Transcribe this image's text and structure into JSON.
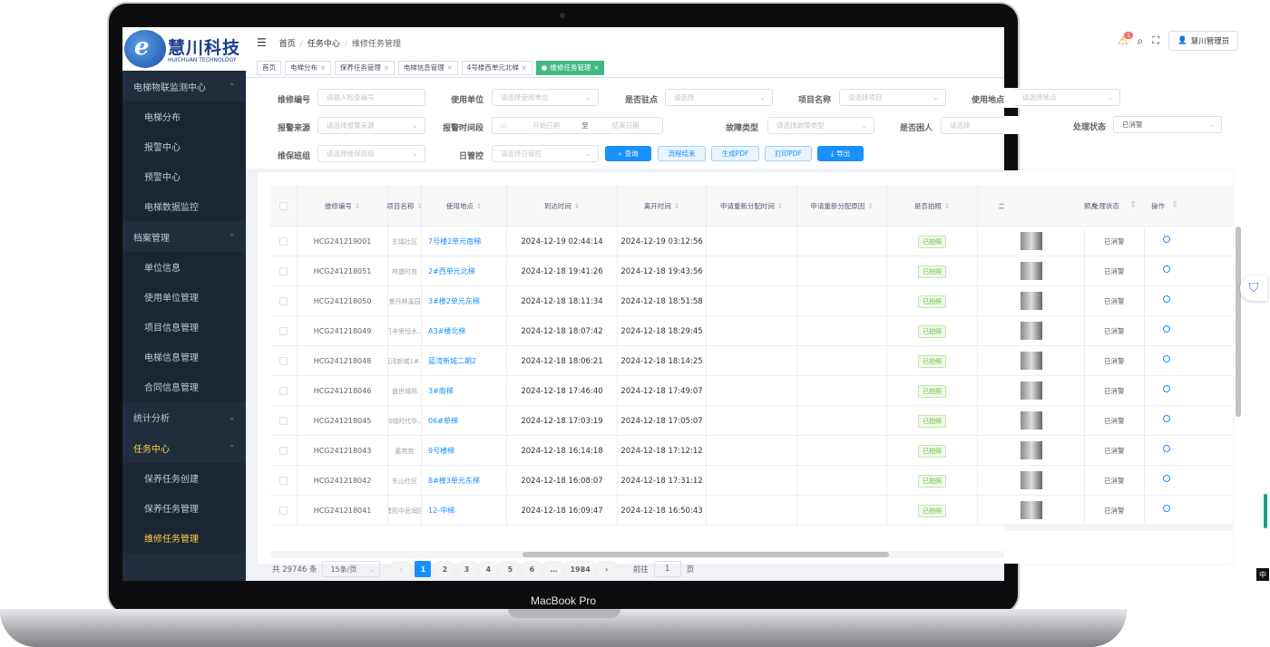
{
  "device": {
    "brand_label": "MacBook Pro"
  },
  "header": {
    "logo_cn": "慧川科技",
    "logo_en": "HUICHUAN TECHNOLOGY",
    "breadcrumb": [
      "首页",
      "任务中心",
      "维修任务管理"
    ],
    "notification_count": "1",
    "user_label": "慧川管理员"
  },
  "tabs": [
    {
      "label": "首页",
      "closable": false,
      "active": false
    },
    {
      "label": "电梯分布",
      "closable": true,
      "active": false
    },
    {
      "label": "保养任务管理",
      "closable": true,
      "active": false
    },
    {
      "label": "电梯信息管理",
      "closable": true,
      "active": false
    },
    {
      "label": "4号楼西单元北梯",
      "closable": true,
      "active": false
    },
    {
      "label": "维修任务管理",
      "closable": true,
      "active": true
    }
  ],
  "sidebar": {
    "groups": [
      {
        "label": "电梯物联监测中心",
        "expanded": true,
        "items": [
          "电梯分布",
          "报警中心",
          "预警中心",
          "电梯数据监控"
        ]
      },
      {
        "label": "档案管理",
        "expanded": true,
        "items": [
          "单位信息",
          "使用单位管理",
          "项目信息管理",
          "电梯信息管理",
          "合同信息管理"
        ]
      },
      {
        "label": "统计分析",
        "expanded": false,
        "items": []
      },
      {
        "label": "任务中心",
        "expanded": true,
        "active": true,
        "items": [
          "保养任务创建",
          "保养任务管理",
          "维修任务管理"
        ]
      }
    ],
    "active_item": "维修任务管理"
  },
  "filters": {
    "row1": [
      {
        "label": "维修编号",
        "placeholder": "请输入检查编号"
      },
      {
        "label": "使用单位",
        "placeholder": "请选择使用单位"
      },
      {
        "label": "是否驻点",
        "placeholder": "请选择"
      },
      {
        "label": "项目名称",
        "placeholder": "请选择项目"
      },
      {
        "label": "使用地点",
        "placeholder": "请选择地点"
      }
    ],
    "row2": [
      {
        "label": "报警来源",
        "placeholder": "请选择报警来源"
      },
      {
        "label": "报警时间段",
        "start": "开始日期",
        "to": "至",
        "end": "结束日期"
      },
      {
        "label": "故障类型",
        "placeholder": "请选择故障类型"
      },
      {
        "label": "是否困人",
        "placeholder": "请选择"
      },
      {
        "label": "处理状态",
        "value": "已消警"
      }
    ],
    "row3": [
      {
        "label": "维保班组",
        "placeholder": "请选择维保班组"
      },
      {
        "label": "日管控",
        "placeholder": "请选择日管控"
      }
    ],
    "buttons": {
      "search": "查询",
      "flow": "流程结束",
      "pdf": "生成PDF",
      "print": "打印PDF",
      "export": "导出"
    }
  },
  "table": {
    "columns": [
      "维修编号",
      "项目名称",
      "使用地点",
      "到达时间",
      "离开时间",
      "申请重新分配时间",
      "申请重新分配原因",
      "是否拍照",
      "二修照片",
      "处理状态",
      "操作"
    ],
    "rows": [
      {
        "id": "HCG241219001",
        "project": "东瑞社区",
        "place": "7号楼2单元南梯",
        "arrive": "2024-12-19 02:44:14",
        "leave": "2024-12-19 03:12:56",
        "photo": "已拍照",
        "status": "已消警"
      },
      {
        "id": "HCG241218051",
        "project": "林盛时苑",
        "place": "2#西单元北梯",
        "arrive": "2024-12-18 19:41:26",
        "leave": "2024-12-18 19:43:56",
        "photo": "已拍照",
        "status": "已消警"
      },
      {
        "id": "HCG241218050",
        "project": "景丹林溪园",
        "place": "3#楼2单元东梯",
        "arrive": "2024-12-18 18:11:34",
        "leave": "2024-12-18 18:51:58",
        "photo": "已拍照",
        "status": "已消警"
      },
      {
        "id": "HCG241218049",
        "project": "万辛里恒水...",
        "place": "A3#楼北梯",
        "arrive": "2024-12-18 18:07:42",
        "leave": "2024-12-18 18:29:45",
        "photo": "已拍照",
        "status": "已消警"
      },
      {
        "id": "HCG241218048",
        "project": "蓝湾新城1#...",
        "place": "蓝湾新城二期2",
        "arrive": "2024-12-18 18:06:21",
        "leave": "2024-12-18 18:14:25",
        "photo": "已拍照",
        "status": "已消警"
      },
      {
        "id": "HCG241218046",
        "project": "盛世城邦",
        "place": "3#南梯",
        "arrive": "2024-12-18 17:46:40",
        "leave": "2024-12-18 17:49:07",
        "photo": "已拍照",
        "status": "已消警"
      },
      {
        "id": "HCG241218045",
        "project": "和城时代华...",
        "place": "06#单梯",
        "arrive": "2024-12-18 17:03:19",
        "leave": "2024-12-18 17:05:07",
        "photo": "已拍照",
        "status": "已消警"
      },
      {
        "id": "HCG241218043",
        "project": "嘉苑苑",
        "place": "9号楼梯",
        "arrive": "2024-12-18 16:14:18",
        "leave": "2024-12-18 17:12:12",
        "photo": "已拍照",
        "status": "已消警"
      },
      {
        "id": "HCG241218042",
        "project": "东山社区",
        "place": "8#楼3单元东梯",
        "arrive": "2024-12-18 16:08:07",
        "leave": "2024-12-18 17:31:12",
        "photo": "已拍照",
        "status": "已消警"
      },
      {
        "id": "HCG241218041",
        "project": "建阳中岳润园",
        "place": "12-中梯",
        "arrive": "2024-12-18 16:09:47",
        "leave": "2024-12-18 16:50:43",
        "photo": "已拍照",
        "status": "已消警"
      }
    ]
  },
  "pagination": {
    "total": "共 29746 条",
    "page_size": "15条/页",
    "pages": [
      "1",
      "2",
      "3",
      "4",
      "5",
      "6",
      "…",
      "1984"
    ],
    "current": "1",
    "goto_label": "前往",
    "goto_value": "1",
    "page_suffix": "页"
  },
  "ime_label": "中",
  "colors": {
    "sidebar_bg": "#1f2d3d",
    "active_menu": "#ffd04b",
    "primary": "#1890ff",
    "active_tag": "#42b983",
    "photo_badge": "#67c23a"
  }
}
